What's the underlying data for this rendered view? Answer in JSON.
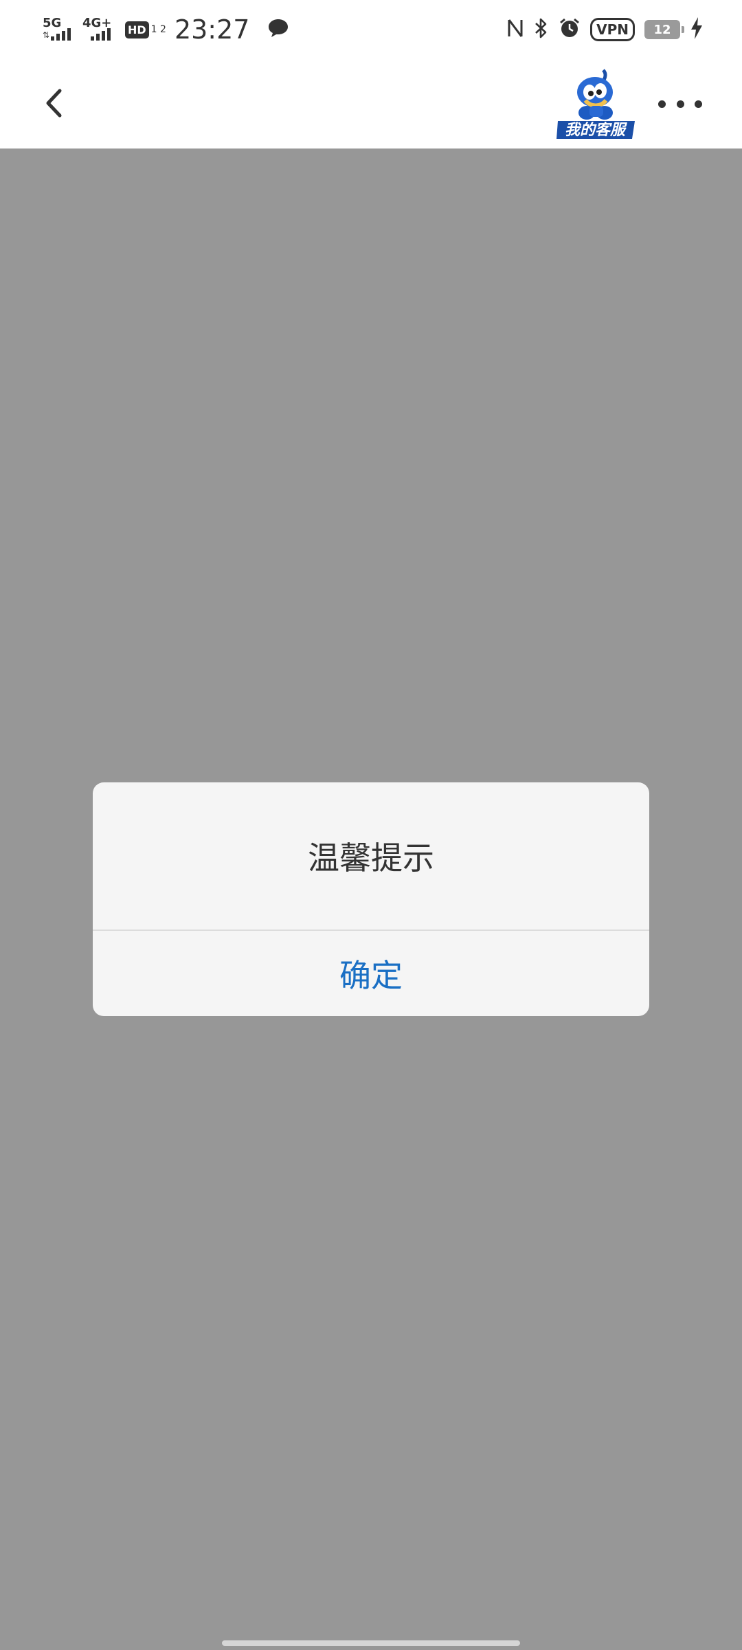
{
  "status_bar": {
    "network1": "5G",
    "network2": "4G+",
    "hd_label": "HD",
    "hd_sub": "1 2",
    "time": "23:27",
    "vpn": "VPN",
    "battery": "12",
    "icons": [
      "message-icon",
      "nfc-icon",
      "bluetooth-icon",
      "alarm-icon",
      "charging-icon"
    ]
  },
  "header": {
    "logo_text": "我的客服",
    "icons": [
      "back-arrow-icon",
      "more-icon"
    ]
  },
  "dialog": {
    "title": "温馨提示",
    "confirm_label": "确定"
  },
  "colors": {
    "overlay": "#979797",
    "dialog_bg": "#f5f5f5",
    "accent": "#1a6fc4"
  }
}
